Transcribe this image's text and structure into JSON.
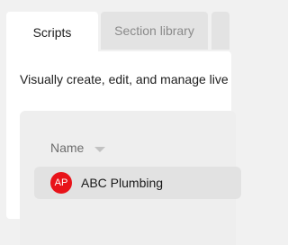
{
  "tabs": [
    {
      "label": "Scripts",
      "active": true
    },
    {
      "label": "Section library",
      "active": false
    }
  ],
  "description": "Visually create, edit, and manage live",
  "list": {
    "column_header": "Name",
    "rows": [
      {
        "avatar_initials": "AP",
        "avatar_color": "#e8131a",
        "name": "ABC Plumbing"
      }
    ]
  }
}
